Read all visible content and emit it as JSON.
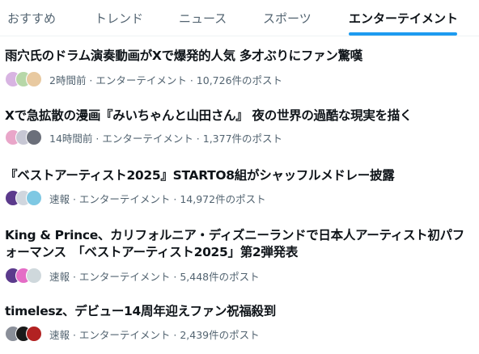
{
  "tabs": [
    {
      "label": "おすすめ",
      "active": false
    },
    {
      "label": "トレンド",
      "active": false
    },
    {
      "label": "ニュース",
      "active": false
    },
    {
      "label": "スポーツ",
      "active": false
    },
    {
      "label": "エンターテイメント",
      "active": true
    }
  ],
  "accent_color": "#1d9bf0",
  "trends": [
    {
      "title": "雨穴氏のドラム演奏動画がXで爆発的人気 多才ぶりにファン驚嘆",
      "meta": "2時間前 · エンターテイメント · 10,726件のポスト",
      "avatar_colors": [
        "#d8b4e2",
        "#b7d7a8",
        "#e8c9a0"
      ]
    },
    {
      "title": "Xで急拡散の漫画『みいちゃんと山田さん』 夜の世界の過酷な現実を描く",
      "meta": "14時間前 · エンターテイメント · 1,377件のポスト",
      "avatar_colors": [
        "#e9a6c9",
        "#c7c7d4",
        "#6b6f7a"
      ]
    },
    {
      "title": "『ベストアーティスト2025』STARTO8組がシャッフルメドレー披露",
      "meta": "速報 · エンターテイメント · 14,972件のポスト",
      "avatar_colors": [
        "#5b3a8c",
        "#d0d6de",
        "#7ec8e3"
      ]
    },
    {
      "title": "King & Prince、カリフォルニア・ディズニーランドで日本人アーティスト初パフォーマンス　「ベストアーティスト2025」第2弾発表",
      "meta": "速報 · エンターテイメント · 5,448件のポスト",
      "avatar_colors": [
        "#5b3a8c",
        "#e46cc6",
        "#cfd8dc"
      ]
    },
    {
      "title": "timelesz、デビュー14周年迎えファン祝福殺到",
      "meta": "速報 · エンターテイメント · 2,439件のポスト",
      "avatar_colors": [
        "#8a8f99",
        "#1a1a1a",
        "#b22222"
      ]
    }
  ]
}
